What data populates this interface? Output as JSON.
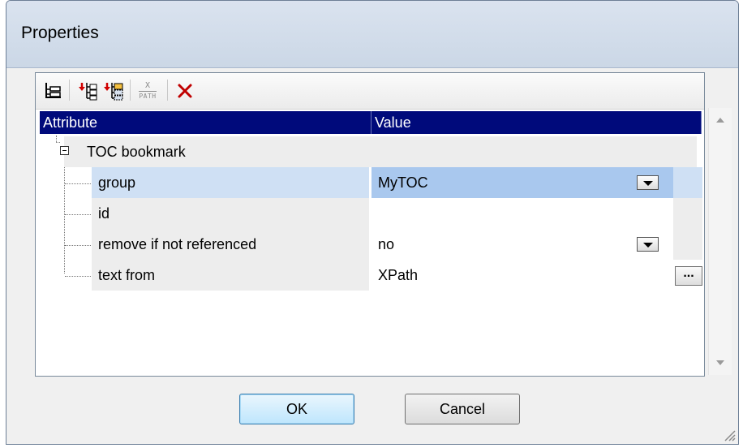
{
  "window": {
    "title": "Properties"
  },
  "toolbar": {
    "items": [
      {
        "icon": "expand-tree-icon"
      },
      {
        "icon": "add-attribute-icon"
      },
      {
        "icon": "add-element-icon"
      },
      {
        "icon": "xpath-icon",
        "label_top": "X",
        "label_bottom": "PATH"
      },
      {
        "icon": "delete-icon"
      }
    ]
  },
  "grid": {
    "columns": [
      "Attribute",
      "Value"
    ],
    "group": "TOC bookmark",
    "rows": [
      {
        "name": "group",
        "value": "MyTOC",
        "control": "dropdown",
        "selected": true
      },
      {
        "name": "id",
        "value": "",
        "control": "none"
      },
      {
        "name": "remove if not referenced",
        "value": "no",
        "control": "dropdown"
      },
      {
        "name": "text from",
        "value": "XPath",
        "control": "ellipsis",
        "ellipsis_label": "..."
      }
    ]
  },
  "buttons": {
    "ok": "OK",
    "cancel": "Cancel"
  },
  "colors": {
    "header_bg": "#000a7b",
    "selected_value_bg": "#a9c8ee",
    "delete_icon": "#c00000"
  }
}
